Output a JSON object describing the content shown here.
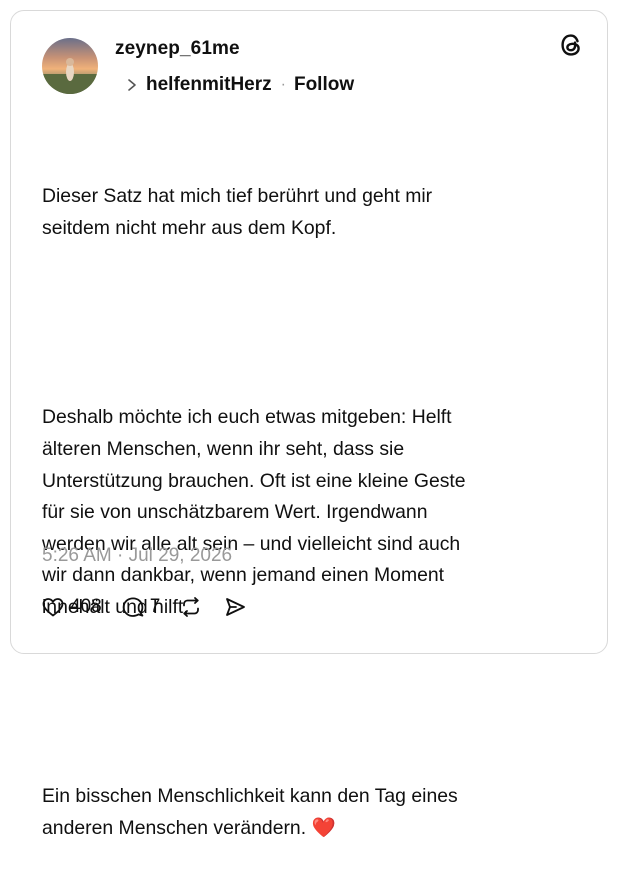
{
  "post": {
    "username": "zeynep_61me",
    "topic": "helfenmitHerz",
    "separator": "·",
    "follow_label": "Follow",
    "paragraphs": [
      "Dieser Satz hat mich tief berührt und geht mir\nseitdem nicht mehr aus dem Kopf.",
      "Deshalb möchte ich euch etwas mitgeben: Helft\nälteren Menschen, wenn ihr seht, dass sie\nUnterstützung brauchen. Oft ist eine kleine Geste\nfür sie von unschätzbarem Wert. Irgendwann\nwerden wir alle alt sein – und vielleicht sind auch\nwir dann dankbar, wenn jemand einen Moment\ninnehält und hilft.",
      "Ein bisschen Menschlichkeit kann den Tag eines\nanderen Menschen verändern."
    ],
    "emoji": "❤️",
    "timestamp": "5:26 AM · Jul 29, 2026",
    "likes": "408",
    "replies": "7"
  },
  "icons": {
    "threads": "threads-logo-icon",
    "chevron": "chevron-right-icon",
    "like": "heart-outline-icon",
    "reply": "comment-bubble-icon",
    "repost": "repost-icon",
    "share": "send-icon"
  },
  "colors": {
    "text": "#101010",
    "muted": "#999999",
    "border": "#d9d9d9",
    "heart": "#e0245e"
  }
}
